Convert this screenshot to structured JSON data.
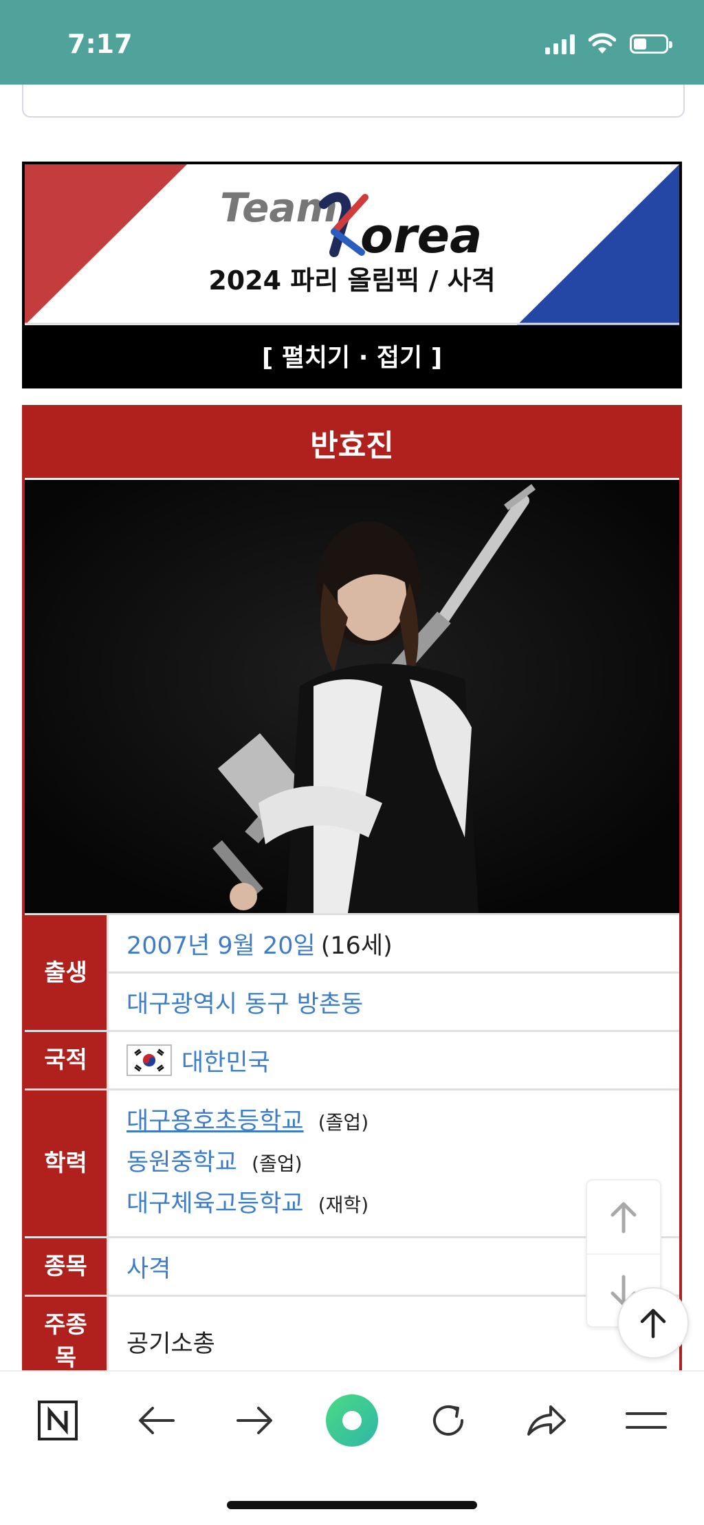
{
  "status": {
    "time": "7:17"
  },
  "banner": {
    "logo_text": "Team Korea",
    "subtitle": "2024 파리 올림픽 / 사격",
    "toggle": "[ 펼치기 · 접기 ]"
  },
  "infobox": {
    "title": "반효진",
    "rows": {
      "birth_label": "출생",
      "birth_date": "2007년 9월 20일",
      "birth_age": "(16세)",
      "birth_place": "대구광역시 동구 방촌동",
      "nation_label": "국적",
      "nation": "대한민국",
      "edu_label": "학력",
      "edu": [
        {
          "school": "대구용호초등학교",
          "status": "(졸업)"
        },
        {
          "school": "동원중학교",
          "status": "(졸업)"
        },
        {
          "school": "대구체육고등학교",
          "status": "(재학)"
        }
      ],
      "sport_label": "종목",
      "sport": "사격",
      "event_label": "주종목",
      "event": "공기소총"
    }
  },
  "colors": {
    "accent": "#b0211d",
    "link": "#3d7cc9",
    "status_bar": "#4fa39a"
  },
  "icons": [
    "wifi-icon",
    "signal-icon",
    "battery-icon",
    "naver-icon",
    "back-arrow-icon",
    "forward-arrow-icon",
    "green-dot-icon",
    "reload-icon",
    "share-icon",
    "menu-icon",
    "scroll-up-icon",
    "scroll-down-icon",
    "to-top-icon"
  ]
}
